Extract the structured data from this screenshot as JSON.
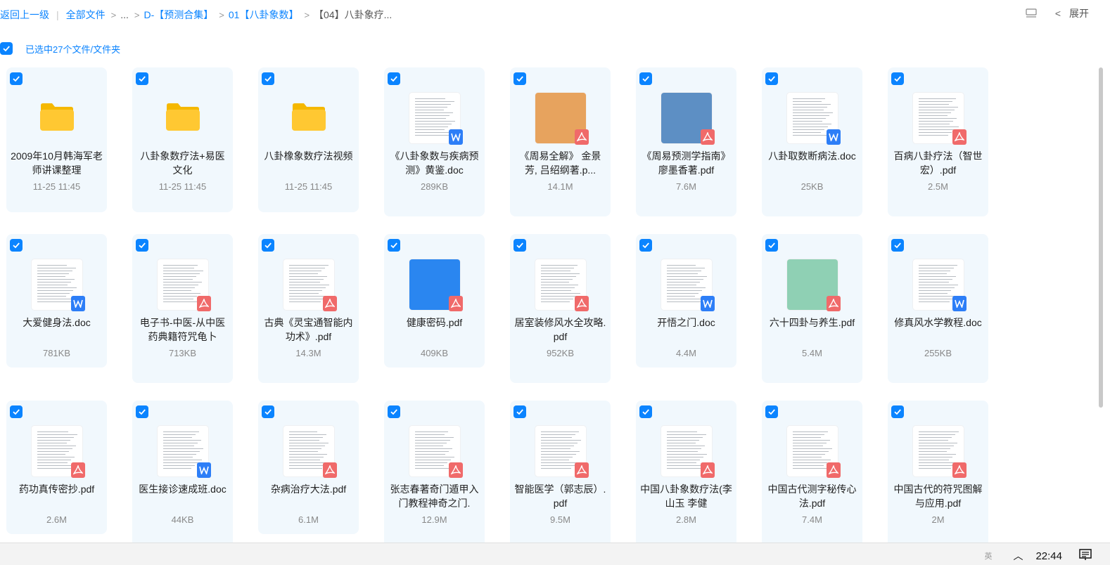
{
  "breadcrumb": {
    "back": "返回上一级",
    "all_files": "全部文件",
    "ellipsis": "...",
    "level1": "D-【预测合集】",
    "level2": "01【八卦象数】",
    "current": "【04】八卦象疗..."
  },
  "top_right": {
    "expand": "展开",
    "list_icon": "list-view-icon",
    "chevron_icon": "chevron-left-icon"
  },
  "selection": {
    "label": "已选中27个文件/文件夹"
  },
  "files": [
    {
      "name": "2009年10月韩海军老师讲课整理",
      "meta": "11-25 11:45",
      "type": "folder"
    },
    {
      "name": "八卦象数疗法+易医文化",
      "meta": "11-25 11:45",
      "type": "folder"
    },
    {
      "name": "八卦橡象数疗法视频",
      "meta": "11-25 11:45",
      "type": "folder"
    },
    {
      "name": "《八卦象数与疾病预测》黄鉴.doc",
      "meta": "289KB",
      "type": "word"
    },
    {
      "name": "《周易全解》 金景芳, 吕绍纲著.p...",
      "meta": "14.1M",
      "type": "pdf"
    },
    {
      "name": "《周易预测学指南》廖墨香著.pdf",
      "meta": "7.6M",
      "type": "pdf"
    },
    {
      "name": "八卦取数断病法.doc",
      "meta": "25KB",
      "type": "word"
    },
    {
      "name": "百病八卦疗法（智世宏）.pdf",
      "meta": "2.5M",
      "type": "pdf"
    },
    {
      "name": "大爱健身法.doc",
      "meta": "781KB",
      "type": "word"
    },
    {
      "name": "电子书-中医-从中医药典籍符咒龟卜",
      "meta": "713KB",
      "type": "pdf"
    },
    {
      "name": "古典《灵宝通智能内功术》.pdf",
      "meta": "14.3M",
      "type": "pdf"
    },
    {
      "name": "健康密码.pdf",
      "meta": "409KB",
      "type": "pdf"
    },
    {
      "name": "居室装修风水全攻略.pdf",
      "meta": "952KB",
      "type": "pdf"
    },
    {
      "name": "开悟之门.doc",
      "meta": "4.4M",
      "type": "word"
    },
    {
      "name": "六十四卦与养生.pdf",
      "meta": "5.4M",
      "type": "pdf"
    },
    {
      "name": "修真风水学教程.doc",
      "meta": "255KB",
      "type": "word"
    },
    {
      "name": "药功真传密抄.pdf",
      "meta": "2.6M",
      "type": "pdf"
    },
    {
      "name": "医生接诊速成班.doc",
      "meta": "44KB",
      "type": "word"
    },
    {
      "name": "杂病治疗大法.pdf",
      "meta": "6.1M",
      "type": "pdf"
    },
    {
      "name": "张志春著奇门遁甲入门教程神奇之门.",
      "meta": "12.9M",
      "type": "pdf"
    },
    {
      "name": "智能医学（郭志辰）.pdf",
      "meta": "9.5M",
      "type": "pdf"
    },
    {
      "name": "中国八卦象数疗法(李山玉 李健",
      "meta": "2.8M",
      "type": "pdf"
    },
    {
      "name": "中国古代测字秘传心法.pdf",
      "meta": "7.4M",
      "type": "pdf"
    },
    {
      "name": "中国古代的符咒图解与应用.pdf",
      "meta": "2M",
      "type": "pdf"
    }
  ],
  "thumb_colors": {
    "folder": "#ffc832",
    "周易全解": "#e7a35e",
    "周易预测": "#5d8fc4",
    "健康密码": "#2a86f0",
    "六十四卦": "#8fd0b4"
  },
  "taskbar": {
    "ime": "英",
    "up_icon": "chevron-up-icon",
    "time": "22:44",
    "notify_icon": "notification-icon"
  }
}
